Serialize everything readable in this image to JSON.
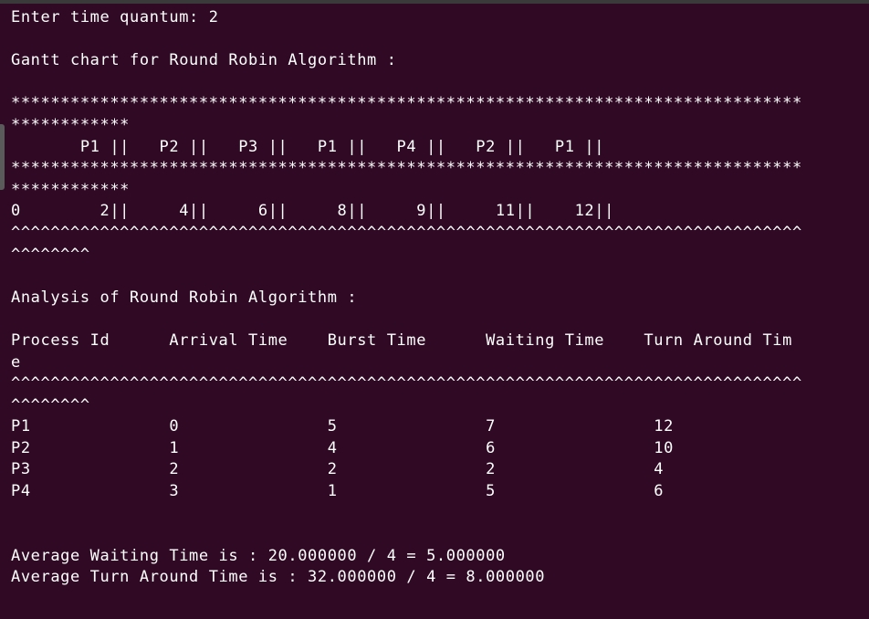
{
  "terminal": {
    "lines": [
      "Enter time quantum: 2",
      "",
      "Gantt chart for Round Robin Algorithm :",
      "",
      "********************************************************************************",
      "************",
      "       P1 ||   P2 ||   P3 ||   P1 ||   P4 ||   P2 ||   P1 ||",
      "********************************************************************************",
      "************",
      "0        2||     4||     6||     8||     9||     11||    12||",
      "^^^^^^^^^^^^^^^^^^^^^^^^^^^^^^^^^^^^^^^^^^^^^^^^^^^^^^^^^^^^^^^^^^^^^^^^^^^^^^^^",
      "^^^^^^^^",
      "",
      "Analysis of Round Robin Algorithm :",
      "",
      "Process Id      Arrival Time    Burst Time      Waiting Time    Turn Around Tim",
      "e",
      "^^^^^^^^^^^^^^^^^^^^^^^^^^^^^^^^^^^^^^^^^^^^^^^^^^^^^^^^^^^^^^^^^^^^^^^^^^^^^^^^",
      "^^^^^^^^",
      "P1              0               5               7                12",
      "P2              1               4               6                10",
      "P3              2               2               2                4",
      "P4              3               1               5                6",
      "",
      "",
      "Average Waiting Time is : 20.000000 / 4 = 5.000000",
      "Average Turn Around Time is : 32.000000 / 4 = 8.000000"
    ]
  }
}
